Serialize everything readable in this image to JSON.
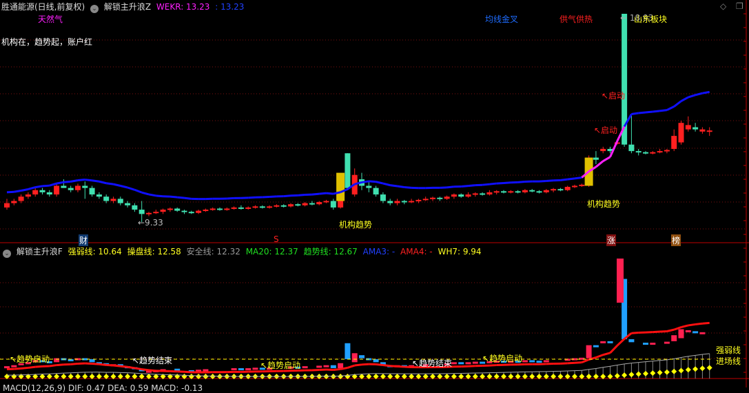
{
  "header": {
    "stock": "胜通能源(日线,前复权)",
    "indicator": "解锁主升浪Z",
    "wekr_label": "WEKR: 13.23",
    "wekr2": ": 13.23"
  },
  "upper_labels": {
    "sector1": "天然气",
    "slogan": "机构在，趋势起，账户红",
    "tag_ma_cross": "均线金叉",
    "tag_gas": "供气供热",
    "tag_region": "山东板块",
    "high_price": "← 18.93",
    "low_price": "←9.33",
    "start1": "↖启动",
    "start2": "↖启动",
    "inst1": "机构趋势",
    "inst2": "机构趋势"
  },
  "markers": {
    "cai": "财",
    "s": "S",
    "zhang": "涨",
    "bang": "榜"
  },
  "lower_header": {
    "name": "解锁主升浪F",
    "qrx": "强弱线: 10.64",
    "cpx": "操盘线: 12.58",
    "aqx": "安全线: 12.32",
    "ma20": "MA20: 12.37",
    "qsx": "趋势线: 12.67",
    "ama3": "AMA3: -",
    "ama4": "AMA4: -",
    "wh7": "WH7: 9.94"
  },
  "lower_labels": {
    "t1": "↖趋势启动",
    "t2": "↖趋势结束",
    "t3": "↖趋势启动",
    "t4": "↖趋势结束",
    "t5": "↖趋势启动",
    "qrx": "强弱线",
    "jcx": "进场线"
  },
  "bottom_header": "MACD(12,26,9)  DIF: 0.47  DEA: 0.59  MACD: -0.13",
  "colors": {
    "up": "#ff2020",
    "down": "#40e0b0",
    "ma": "#1010ff",
    "ma_hot": "#ff20ff",
    "yellow": "#ffff00"
  },
  "chart_data": {
    "type": "candlestick",
    "price_range": [
      9.33,
      18.93
    ],
    "candles": [
      [
        10.0,
        10.2,
        10.4,
        9.9
      ],
      [
        10.2,
        10.3,
        10.4,
        10.1
      ],
      [
        10.3,
        10.5,
        10.6,
        10.2
      ],
      [
        10.5,
        10.6,
        10.7,
        10.4
      ],
      [
        10.6,
        10.8,
        10.9,
        10.5
      ],
      [
        10.8,
        10.7,
        10.9,
        10.6
      ],
      [
        10.7,
        10.6,
        10.8,
        10.5
      ],
      [
        10.6,
        11.0,
        11.1,
        10.5
      ],
      [
        11.0,
        10.9,
        11.3,
        10.9
      ],
      [
        10.9,
        10.8,
        11.0,
        10.7
      ],
      [
        10.8,
        11.0,
        11.1,
        10.7
      ],
      [
        11.0,
        10.9,
        11.2,
        10.4
      ],
      [
        10.9,
        10.6,
        11.0,
        10.5
      ],
      [
        10.6,
        10.5,
        10.7,
        10.4
      ],
      [
        10.5,
        10.3,
        10.6,
        10.2
      ],
      [
        10.3,
        10.4,
        10.5,
        10.2
      ],
      [
        10.4,
        10.2,
        10.5,
        10.1
      ],
      [
        10.2,
        10.1,
        10.3,
        10.0
      ],
      [
        10.1,
        9.9,
        10.2,
        9.8
      ],
      [
        9.9,
        9.7,
        10.3,
        9.33
      ],
      [
        9.7,
        9.75,
        9.8,
        9.6
      ],
      [
        9.75,
        9.8,
        9.9,
        9.7
      ],
      [
        9.8,
        9.9,
        9.95,
        9.7
      ],
      [
        9.9,
        9.95,
        10.0,
        9.8
      ],
      [
        9.95,
        9.85,
        10.0,
        9.8
      ],
      [
        9.85,
        9.8,
        9.9,
        9.7
      ],
      [
        9.8,
        9.75,
        9.85,
        9.7
      ],
      [
        9.75,
        9.85,
        9.9,
        9.7
      ],
      [
        9.85,
        9.9,
        9.95,
        9.8
      ],
      [
        9.9,
        9.95,
        10.0,
        9.85
      ],
      [
        9.95,
        9.9,
        10.0,
        9.85
      ],
      [
        9.9,
        9.95,
        10.0,
        9.85
      ],
      [
        9.95,
        10.0,
        10.05,
        9.9
      ],
      [
        10.0,
        9.95,
        10.1,
        9.9
      ],
      [
        9.95,
        10.0,
        10.05,
        9.9
      ],
      [
        10.0,
        10.05,
        10.1,
        9.95
      ],
      [
        10.05,
        10.0,
        10.1,
        9.95
      ],
      [
        10.0,
        10.05,
        10.1,
        9.95
      ],
      [
        10.05,
        10.1,
        10.15,
        10.0
      ],
      [
        10.1,
        10.05,
        10.15,
        10.0
      ],
      [
        10.05,
        10.15,
        10.2,
        10.0
      ],
      [
        10.15,
        10.1,
        10.2,
        10.05
      ],
      [
        10.1,
        10.2,
        10.25,
        10.05
      ],
      [
        10.2,
        10.15,
        10.3,
        10.1
      ],
      [
        10.15,
        10.25,
        10.3,
        10.1
      ],
      [
        10.25,
        10.3,
        10.35,
        10.2
      ],
      [
        10.3,
        10.0,
        10.4,
        9.9
      ],
      [
        10.0,
        10.5,
        10.6,
        9.95
      ],
      [
        12.5,
        10.9,
        12.5,
        10.8
      ],
      [
        10.6,
        11.5,
        11.8,
        10.5
      ],
      [
        11.3,
        11.0,
        11.6,
        10.8
      ],
      [
        11.0,
        10.9,
        11.2,
        10.7
      ],
      [
        10.9,
        10.6,
        11.0,
        10.5
      ],
      [
        10.6,
        10.3,
        10.7,
        10.2
      ],
      [
        10.3,
        10.2,
        10.4,
        10.1
      ],
      [
        10.2,
        10.3,
        10.4,
        10.1
      ],
      [
        10.3,
        10.25,
        10.35,
        10.15
      ],
      [
        10.25,
        10.3,
        10.4,
        10.2
      ],
      [
        10.3,
        10.35,
        10.4,
        10.2
      ],
      [
        10.35,
        10.4,
        10.5,
        10.3
      ],
      [
        10.4,
        10.45,
        10.5,
        10.3
      ],
      [
        10.45,
        10.4,
        10.5,
        10.3
      ],
      [
        10.4,
        10.5,
        10.55,
        10.35
      ],
      [
        10.5,
        10.6,
        10.65,
        10.4
      ],
      [
        10.6,
        10.5,
        10.65,
        10.45
      ],
      [
        10.5,
        10.6,
        10.7,
        10.45
      ],
      [
        10.6,
        10.65,
        10.7,
        10.5
      ],
      [
        10.65,
        10.6,
        10.7,
        10.55
      ],
      [
        10.6,
        10.7,
        10.8,
        10.55
      ],
      [
        10.7,
        10.75,
        10.8,
        10.6
      ],
      [
        10.75,
        10.7,
        10.8,
        10.65
      ],
      [
        10.7,
        10.75,
        10.8,
        10.65
      ],
      [
        10.75,
        10.7,
        10.8,
        10.65
      ],
      [
        10.7,
        10.8,
        10.85,
        10.65
      ],
      [
        10.8,
        10.75,
        10.85,
        10.7
      ],
      [
        10.75,
        10.7,
        10.8,
        10.65
      ],
      [
        10.7,
        10.8,
        10.85,
        10.65
      ],
      [
        10.8,
        10.85,
        10.9,
        10.7
      ],
      [
        10.85,
        10.8,
        10.9,
        10.75
      ],
      [
        10.8,
        10.95,
        11.0,
        10.75
      ],
      [
        10.95,
        11.0,
        11.05,
        10.9
      ],
      [
        11.0,
        11.05,
        11.1,
        10.95
      ],
      [
        11.0,
        12.3,
        12.4,
        10.95
      ],
      [
        12.3,
        12.2,
        12.6,
        12.0
      ],
      [
        12.6,
        12.7,
        12.8,
        12.5
      ],
      [
        12.7,
        12.6,
        12.8,
        12.5
      ],
      [
        13.0,
        13.0,
        13.1,
        12.9
      ],
      [
        18.93,
        12.9,
        18.93,
        12.8
      ],
      [
        12.9,
        12.6,
        14.3,
        12.5
      ],
      [
        12.6,
        12.55,
        12.7,
        12.4
      ],
      [
        12.55,
        12.5,
        12.6,
        12.45
      ],
      [
        12.5,
        12.55,
        12.6,
        12.45
      ],
      [
        12.55,
        12.6,
        12.7,
        12.5
      ],
      [
        12.6,
        12.65,
        12.7,
        12.5
      ],
      [
        12.7,
        13.3,
        13.6,
        12.6
      ],
      [
        13.0,
        13.9,
        14.0,
        12.9
      ],
      [
        13.6,
        13.8,
        14.2,
        13.5
      ],
      [
        13.7,
        13.6,
        13.9,
        13.5
      ],
      [
        13.5,
        13.6,
        13.7,
        13.4
      ],
      [
        13.55,
        13.55,
        13.7,
        13.3
      ]
    ]
  }
}
